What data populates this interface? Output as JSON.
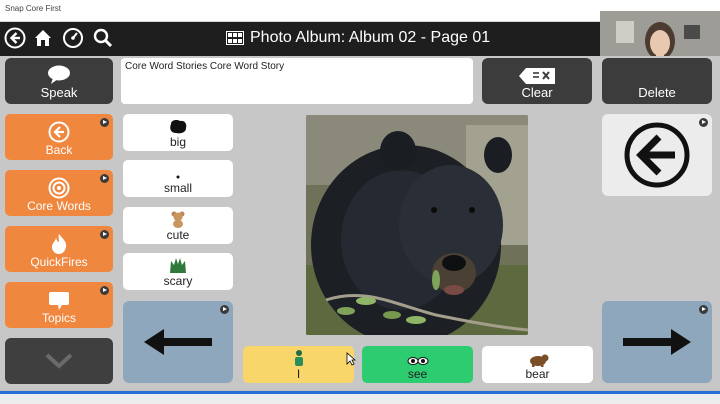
{
  "app": {
    "title": "Snap Core First"
  },
  "nav": {
    "title": "Photo Album: Album 02 - Page 01",
    "icons": [
      "back-circle-icon",
      "home-icon",
      "dashboard-icon",
      "search-icon",
      "album-icon"
    ]
  },
  "toolbar": {
    "speak_label": "Speak",
    "message_text": "Core Word Stories Core Word Story",
    "clear_label": "Clear",
    "delete_label": "Delete"
  },
  "sidebar": {
    "items": [
      {
        "label": "Back",
        "icon": "back-arrow-icon"
      },
      {
        "label": "Core Words",
        "icon": "target-icon"
      },
      {
        "label": "QuickFires",
        "icon": "flame-icon"
      },
      {
        "label": "Topics",
        "icon": "speech-bubble-icon"
      }
    ]
  },
  "words": [
    {
      "label": "big",
      "icon": "big-blob-icon"
    },
    {
      "label": "small",
      "icon": "small-dot-icon"
    },
    {
      "label": "cute",
      "icon": "teddy-bear-icon"
    },
    {
      "label": "scary",
      "icon": "monster-icon"
    }
  ],
  "sentence": [
    {
      "label": "I",
      "icon": "person-icon",
      "color": "#f9d66a"
    },
    {
      "label": "see",
      "icon": "eyes-icon",
      "color": "#2ecc71"
    },
    {
      "label": "bear",
      "icon": "bear-icon",
      "color": "#ffffff"
    }
  ],
  "colors": {
    "sidebar_orange": "#f0873f",
    "blue_nav": "#8ea7bd",
    "dark_button": "#3c3c3c",
    "grid_bg": "#c7c7c7"
  }
}
